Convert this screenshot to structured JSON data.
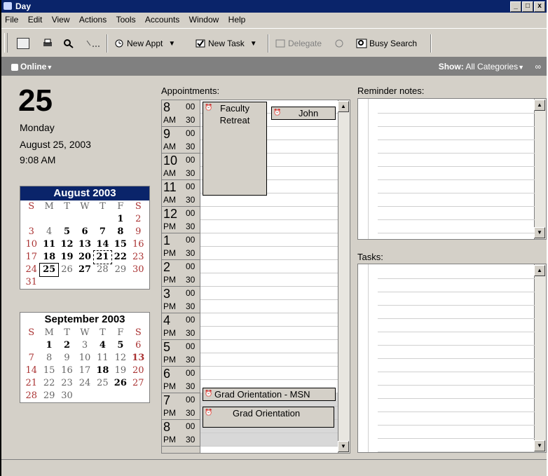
{
  "window": {
    "title": "Day",
    "controls": [
      "_",
      "□",
      "x"
    ]
  },
  "menu": [
    "File",
    "Edit",
    "View",
    "Actions",
    "Tools",
    "Accounts",
    "Window",
    "Help"
  ],
  "toolbar": {
    "new_appt": "New Appt",
    "new_task": "New Task",
    "delegate": "Delegate",
    "busy_search": "Busy Search"
  },
  "status": {
    "online": "Online",
    "show_label": "Show:",
    "show_value": "All Categories"
  },
  "today": {
    "day_number": "25",
    "weekday": "Monday",
    "date": "August 25, 2003",
    "time": "9:08 AM"
  },
  "calendars": [
    {
      "title": "August 2003",
      "weekdays": [
        "S",
        "M",
        "T",
        "W",
        "T",
        "F",
        "S"
      ],
      "days": [
        "",
        "",
        "",
        "",
        "",
        "1",
        "2",
        "3",
        "4",
        "5",
        "6",
        "7",
        "8",
        "9",
        "10",
        "11",
        "12",
        "13",
        "14",
        "15",
        "16",
        "17",
        "18",
        "19",
        "20",
        "21",
        "22",
        "23",
        "24",
        "25",
        "26",
        "27",
        "28",
        "29",
        "30",
        "31"
      ]
    },
    {
      "title": "September 2003",
      "weekdays": [
        "S",
        "M",
        "T",
        "W",
        "T",
        "F",
        "S"
      ],
      "days": [
        "",
        "1",
        "2",
        "3",
        "4",
        "5",
        "6",
        "7",
        "8",
        "9",
        "10",
        "11",
        "12",
        "13",
        "14",
        "15",
        "16",
        "17",
        "18",
        "19",
        "20",
        "21",
        "22",
        "23",
        "24",
        "25",
        "26",
        "27",
        "28",
        "29",
        "30"
      ]
    }
  ],
  "appointments": {
    "label": "Appointments:",
    "hours": [
      {
        "hour": "8",
        "ampm": "AM"
      },
      {
        "hour": "9",
        "ampm": "AM"
      },
      {
        "hour": "10",
        "ampm": "AM"
      },
      {
        "hour": "11",
        "ampm": "AM"
      },
      {
        "hour": "12",
        "ampm": "PM"
      },
      {
        "hour": "1",
        "ampm": "PM"
      },
      {
        "hour": "2",
        "ampm": "PM"
      },
      {
        "hour": "3",
        "ampm": "PM"
      },
      {
        "hour": "4",
        "ampm": "PM"
      },
      {
        "hour": "5",
        "ampm": "PM"
      },
      {
        "hour": "6",
        "ampm": "PM"
      },
      {
        "hour": "7",
        "ampm": "PM"
      },
      {
        "hour": "8",
        "ampm": "PM"
      }
    ],
    "minute_labels": [
      "00",
      "30"
    ],
    "events": [
      "Faculty Retreat",
      "John",
      "Grad Orientation - MSN",
      "Grad Orientation"
    ]
  },
  "reminder": {
    "label": "Reminder notes:"
  },
  "tasks": {
    "label": "Tasks:"
  }
}
